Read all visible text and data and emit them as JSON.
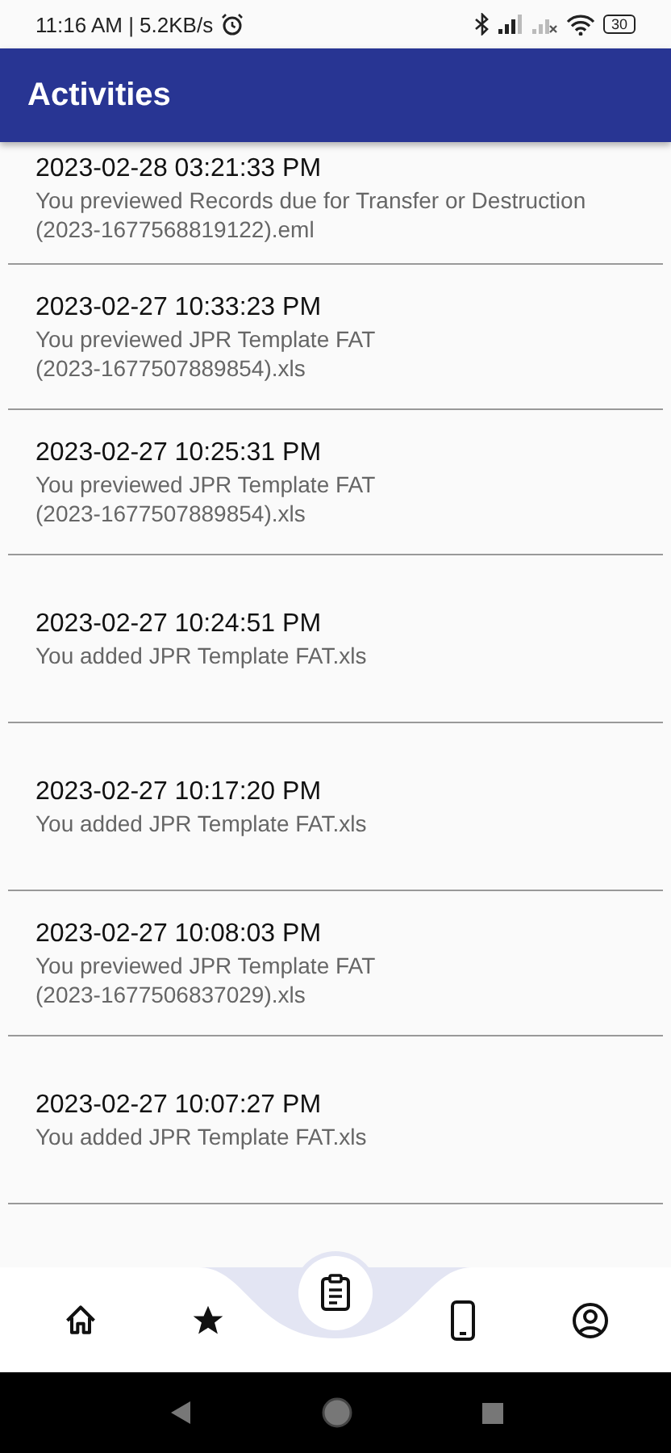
{
  "status_bar": {
    "time": "11:16 AM | 5.2KB/s",
    "battery": "30"
  },
  "app_bar": {
    "title": "Activities"
  },
  "activities": [
    {
      "timestamp": "2023-02-28 03:21:33 PM",
      "description_lines": [
        "You previewed Records due for Transfer or Destruction",
        "(2023-1677568819122).eml"
      ]
    },
    {
      "timestamp": "2023-02-27 10:33:23 PM",
      "description_lines": [
        "You previewed JPR Template FAT",
        "(2023-1677507889854).xls"
      ]
    },
    {
      "timestamp": "2023-02-27 10:25:31 PM",
      "description_lines": [
        "You previewed JPR Template FAT",
        "(2023-1677507889854).xls"
      ]
    },
    {
      "timestamp": "2023-02-27 10:24:51 PM",
      "description_lines": [
        "You added JPR Template FAT.xls"
      ]
    },
    {
      "timestamp": "2023-02-27 10:17:20 PM",
      "description_lines": [
        "You added JPR Template FAT.xls"
      ]
    },
    {
      "timestamp": "2023-02-27 10:08:03 PM",
      "description_lines": [
        "You previewed JPR Template FAT",
        "(2023-1677506837029).xls"
      ]
    },
    {
      "timestamp": "2023-02-27 10:07:27 PM",
      "description_lines": [
        "You added JPR Template FAT.xls"
      ]
    }
  ],
  "bottom_nav": [
    {
      "kind": "home",
      "selected": false
    },
    {
      "kind": "star",
      "selected": false
    },
    {
      "kind": "clipboard",
      "selected": true
    },
    {
      "kind": "phone",
      "selected": false
    },
    {
      "kind": "account",
      "selected": false
    }
  ]
}
